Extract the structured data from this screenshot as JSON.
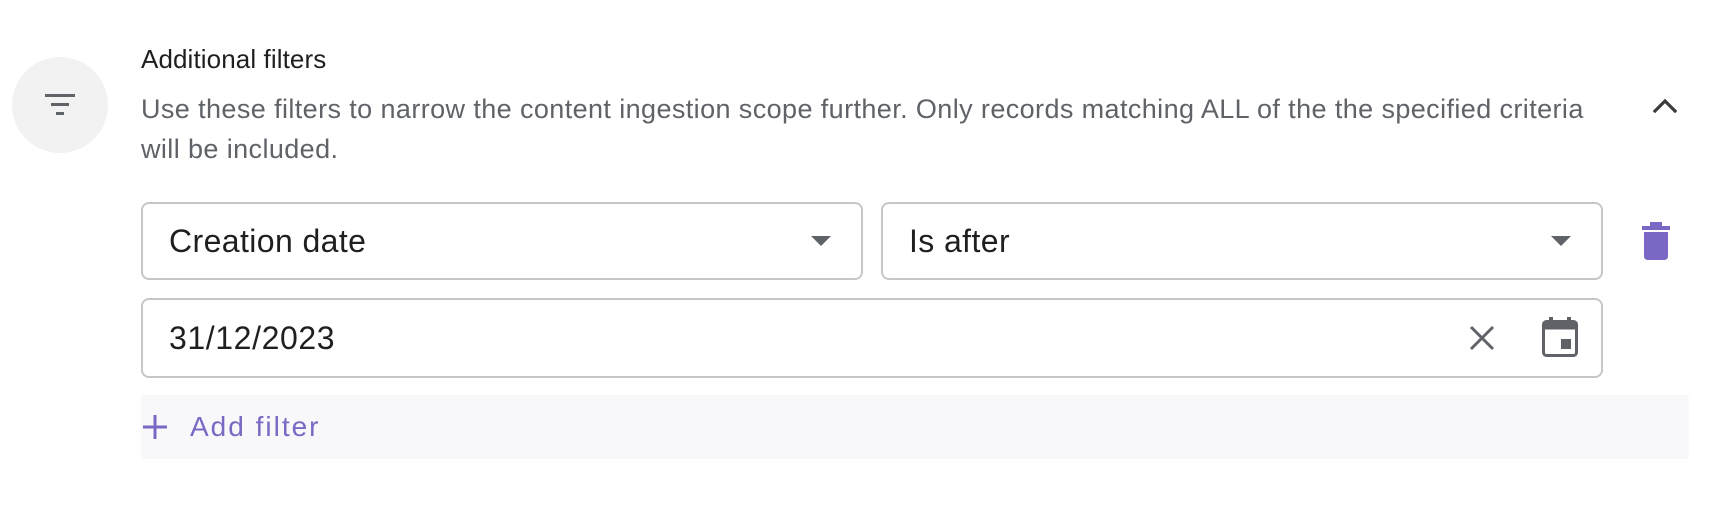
{
  "section": {
    "title": "Additional filters",
    "description": "Use these filters to narrow the content ingestion scope further. Only records matching ALL of the the specified criteria will be included.",
    "icon": "filter-list-icon",
    "collapse_icon": "chevron-up-icon"
  },
  "filter_row": {
    "attribute": "Creation date",
    "operator": "Is after",
    "date_value": "31/12/2023",
    "delete_icon": "trash-icon",
    "clear_icon": "close-icon",
    "calendar_icon": "calendar-icon"
  },
  "add_filter": {
    "label": "Add filter",
    "icon": "plus-icon"
  },
  "colors": {
    "accent": "#7b68c4",
    "icon_gray": "#5f6368",
    "border": "#c7c7c7",
    "avatar_bg": "#f2f2f2",
    "add_bg": "#f8f8fb"
  }
}
